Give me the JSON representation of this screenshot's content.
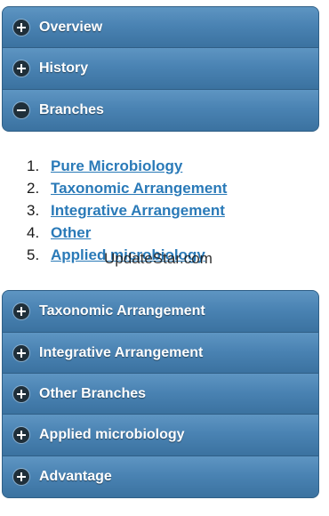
{
  "top_sections": [
    {
      "label": "Overview",
      "icon": "plus-icon",
      "expanded": false
    },
    {
      "label": "History",
      "icon": "plus-icon",
      "expanded": false
    },
    {
      "label": "Branches",
      "icon": "minus-icon",
      "expanded": true
    }
  ],
  "branches": {
    "items": [
      {
        "number": "1.",
        "label": "Pure Microbiology"
      },
      {
        "number": "2.",
        "label": "Taxonomic Arrangement"
      },
      {
        "number": "3.",
        "label": "Integrative Arrangement"
      },
      {
        "number": "4.",
        "label": "Other"
      },
      {
        "number": "5.",
        "label": "Applied microbiology"
      }
    ]
  },
  "watermark": "UpdateStar.com",
  "bottom_sections": [
    {
      "label": "Taxonomic Arrangement",
      "icon": "plus-icon"
    },
    {
      "label": "Integrative Arrangement",
      "icon": "plus-icon"
    },
    {
      "label": "Other Branches",
      "icon": "plus-icon"
    },
    {
      "label": "Applied microbiology",
      "icon": "plus-icon"
    },
    {
      "label": "Advantage",
      "icon": "plus-icon"
    }
  ],
  "colors": {
    "header_top": "#5e95c2",
    "header_bottom": "#3b72a0",
    "link": "#2a7ab8",
    "icon_bg": "#1f2f3a"
  }
}
